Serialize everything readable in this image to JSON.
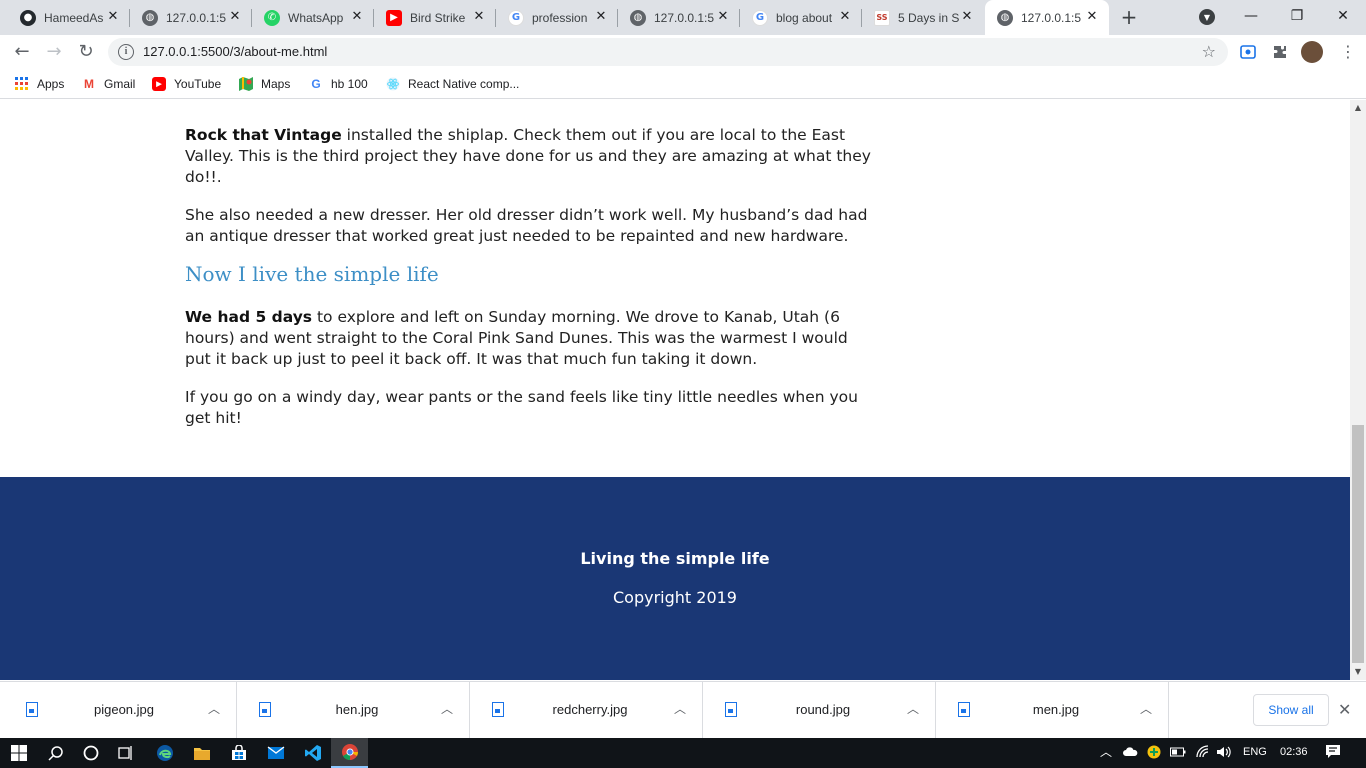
{
  "browser": {
    "tabs": [
      {
        "title": "HameedAs",
        "icon": "github-icon"
      },
      {
        "title": "127.0.0.1:5",
        "icon": "globe-icon"
      },
      {
        "title": "WhatsApp",
        "icon": "whatsapp-icon"
      },
      {
        "title": "Bird Strike",
        "icon": "youtube-icon"
      },
      {
        "title": "profession",
        "icon": "google-icon"
      },
      {
        "title": "127.0.0.1:5",
        "icon": "globe-icon"
      },
      {
        "title": "blog about",
        "icon": "google-icon"
      },
      {
        "title": "5 Days in S",
        "icon": "site-logo-icon"
      },
      {
        "title": "127.0.0.1:5",
        "icon": "globe-icon",
        "active": true
      }
    ],
    "url": "127.0.0.1:5500/3/about-me.html",
    "bookmarks": [
      {
        "label": "Apps",
        "icon": "apps-grid-icon"
      },
      {
        "label": "Gmail",
        "icon": "gmail-icon"
      },
      {
        "label": "YouTube",
        "icon": "youtube-icon"
      },
      {
        "label": "Maps",
        "icon": "maps-icon"
      },
      {
        "label": "hb 100",
        "icon": "google-icon"
      },
      {
        "label": "React Native comp...",
        "icon": "react-icon"
      }
    ]
  },
  "article": {
    "p1_bold": "Rock that Vintage",
    "p1_rest": " installed the shiplap. Check them out if you are local to the East Valley. This is the third project they have done for us and they are amazing at what they do!!.",
    "p2": "She also needed a new dresser. Her old dresser didn’t work well. My husband’s dad had an antique dresser that worked great just needed to be repainted and new hardware.",
    "heading": "Now I live the simple life",
    "p3_bold": "We had 5 days",
    "p3_rest": " to explore and left on Sunday morning. We drove to Kanab, Utah (6 hours) and went straight to the Coral Pink Sand Dunes. This was the warmest I would put it back up just to peel it back off. It was that much fun taking it down.",
    "p4": "If you go on a windy day, wear pants or the sand feels like tiny little needles when you get hit!"
  },
  "footer": {
    "title": "Living the simple life",
    "copyright": "Copyright 2019"
  },
  "downloads": {
    "files": [
      "pigeon.jpg",
      "hen.jpg",
      "redcherry.jpg",
      "round.jpg",
      "men.jpg"
    ],
    "show_all": "Show all"
  },
  "taskbar": {
    "language": "ENG",
    "time": "02:36"
  },
  "colors": {
    "footer_bg": "#1a3775",
    "heading": "#3d8fc6",
    "link_blue": "#1a73e8"
  }
}
